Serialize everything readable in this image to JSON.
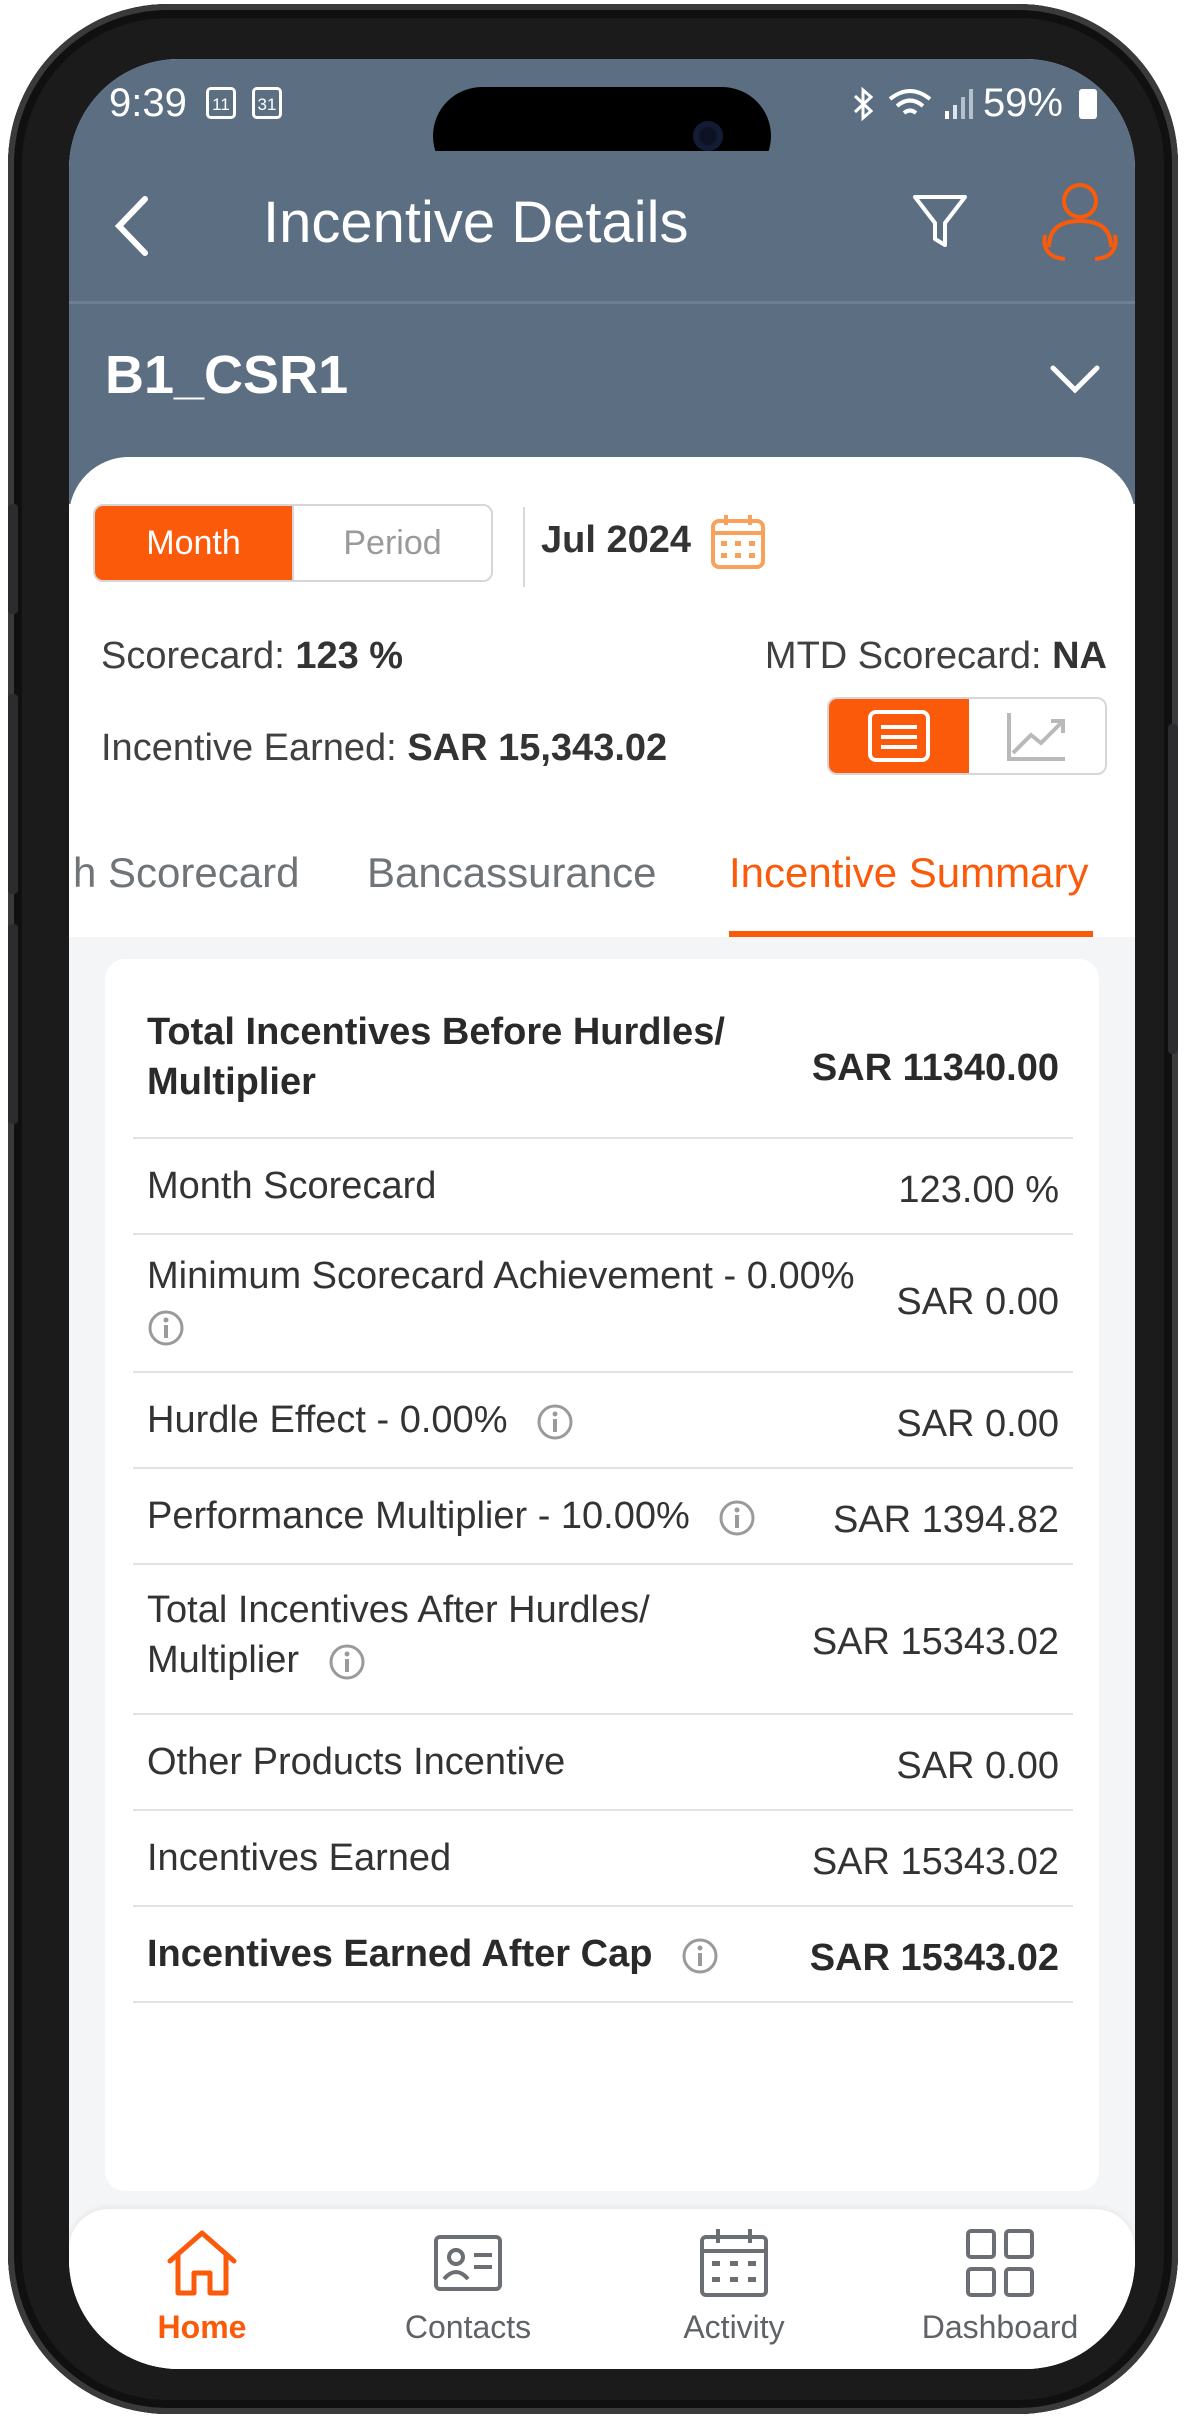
{
  "status_bar": {
    "time": "9:39",
    "cal1": "11",
    "cal2": "31",
    "battery": "59%",
    "icons": [
      "bluetooth-icon",
      "wifi-icon",
      "signal-icon",
      "battery-icon"
    ]
  },
  "header": {
    "title": "Incentive Details",
    "icons": [
      "back-arrow-icon",
      "filter-icon",
      "user-switch-icon"
    ]
  },
  "selector": {
    "label": "B1_CSR1",
    "icon": "chevron-down-icon"
  },
  "period": {
    "month_label": "Month",
    "period_label": "Period",
    "selected": "Month",
    "date": "Jul 2024"
  },
  "stats": {
    "scorecard_label": "Scorecard:",
    "scorecard_value": "123 %",
    "mtd_label": "MTD Scorecard:",
    "mtd_value": "NA",
    "incentive_label": "Incentive Earned:",
    "incentive_value": "SAR 15,343.02"
  },
  "tabs": {
    "items": [
      "h Scorecard",
      "Bancassurance",
      "Incentive Summary"
    ],
    "active": "Incentive Summary"
  },
  "summary": {
    "rows": [
      {
        "label_line1": "Total Incentives Before Hurdles/",
        "label_line2": "Multiplier",
        "value": "SAR 11340.00"
      },
      {
        "label": "Month Scorecard",
        "value": "123.00 %"
      },
      {
        "label": "Minimum Scorecard Achievement - 0.00%",
        "value": "SAR 0.00"
      },
      {
        "label": "Hurdle Effect -  0.00%",
        "value": "SAR 0.00"
      },
      {
        "label": "Performance Multiplier -  10.00%",
        "value": "SAR 1394.82"
      },
      {
        "label_line1": "Total Incentives After Hurdles/",
        "label_line2": "Multiplier",
        "value": "SAR 15343.02"
      },
      {
        "label": "Other Products Incentive",
        "value": "SAR 0.00"
      },
      {
        "label": "Incentives Earned",
        "value": "SAR 15343.02"
      },
      {
        "label": "Incentives Earned After Cap",
        "value": "SAR 15343.02"
      }
    ]
  },
  "bottom_nav": {
    "items": [
      {
        "label": "Home",
        "icon": "home-icon"
      },
      {
        "label": "Contacts",
        "icon": "contact-card-icon"
      },
      {
        "label": "Activity",
        "icon": "calendar-icon"
      },
      {
        "label": "Dashboard",
        "icon": "grid-icon"
      }
    ],
    "active": "Home"
  },
  "colors": {
    "accent": "#fb5a0a",
    "header_bg": "#5b6e82",
    "text": "#333333"
  }
}
